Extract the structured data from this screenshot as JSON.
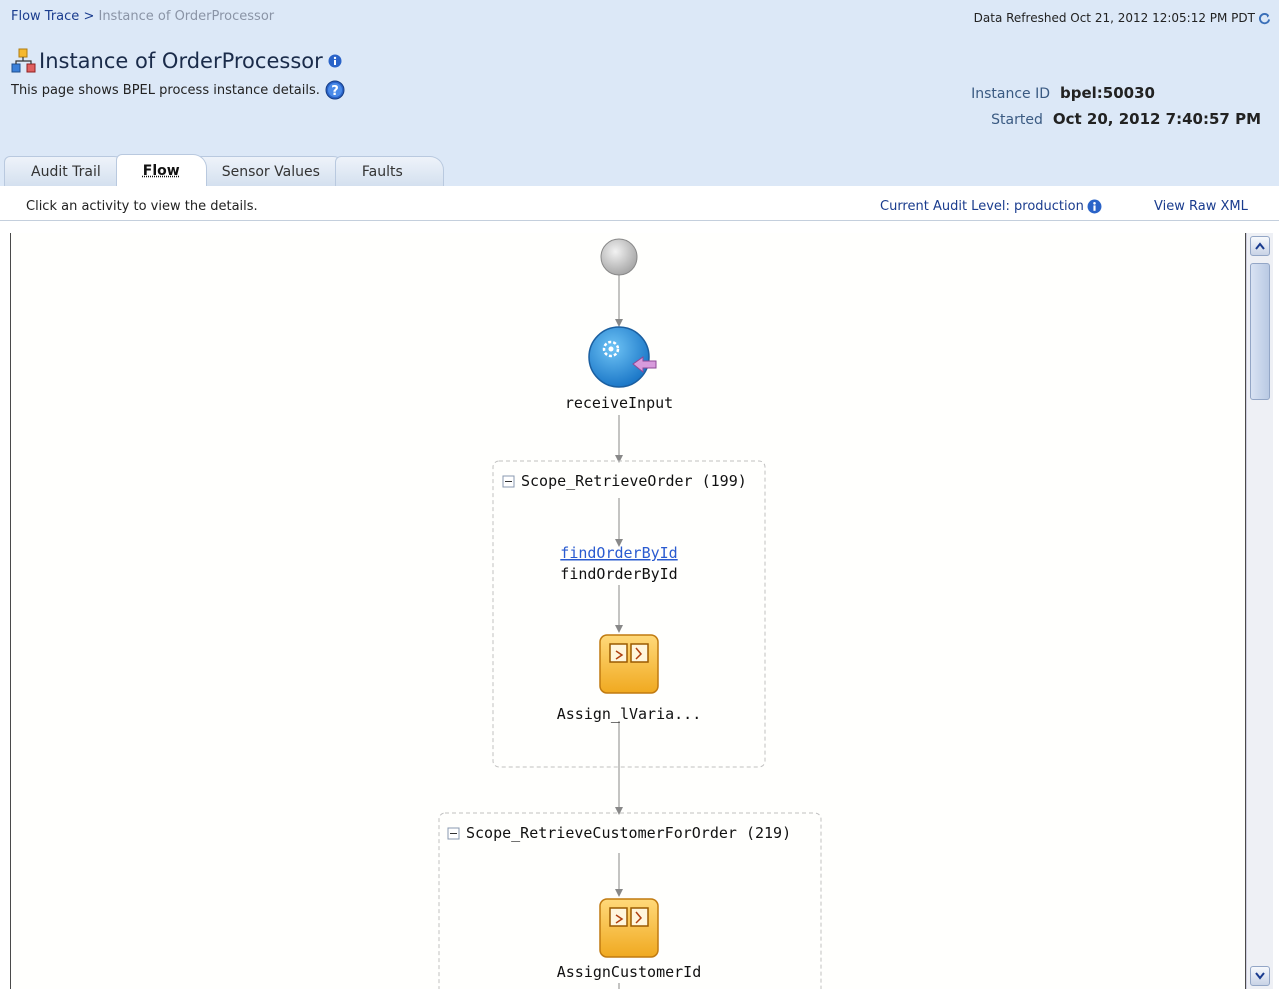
{
  "breadcrumb": {
    "root_label": "Flow Trace",
    "separator": ">",
    "current_label": "Instance of OrderProcessor"
  },
  "refresh": {
    "text": "Data Refreshed Oct 21, 2012 12:05:12 PM PDT",
    "icon": "refresh-icon"
  },
  "page": {
    "title": "Instance of OrderProcessor",
    "description": "This page shows BPEL process instance details.",
    "title_icon": "instance-icon",
    "info_icon": "info-icon",
    "help_icon": "help-icon"
  },
  "instance": {
    "id_label": "Instance ID",
    "id_value": "bpel:50030",
    "started_label": "Started",
    "started_value": "Oct 20, 2012 7:40:57 PM"
  },
  "tabs": [
    {
      "label": "Audit Trail",
      "active": false
    },
    {
      "label": "Flow",
      "active": true
    },
    {
      "label": "Sensor Values",
      "active": false
    },
    {
      "label": "Faults",
      "active": false
    }
  ],
  "toolbar": {
    "hint": "Click an activity to view the details.",
    "audit_level": "Current Audit Level: production",
    "raw_xml": "View Raw XML"
  },
  "flow": {
    "receive_label": "receiveInput",
    "scope1_title": "Scope_RetrieveOrder (199)",
    "invoke_link": "findOrderById",
    "invoke_label": "findOrderById",
    "assign1_label": "Assign_lVaria...",
    "scope2_title": "Scope_RetrieveCustomerForOrder (219)",
    "assign2_label": "AssignCustomerId"
  },
  "colors": {
    "header_bg": "#dce8f7",
    "link": "#1a3c8e",
    "receive_blue": "#2a8fd8",
    "assign_orange": "#f5b82e"
  }
}
